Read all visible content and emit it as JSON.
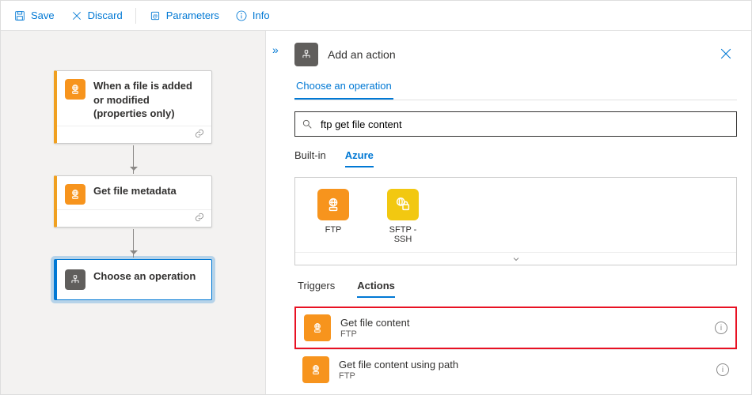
{
  "toolbar": {
    "save": "Save",
    "discard": "Discard",
    "parameters": "Parameters",
    "info": "Info"
  },
  "workflow": {
    "trigger": {
      "title": "When a file is added or modified (properties only)"
    },
    "step1": {
      "title": "Get file metadata"
    },
    "step2": {
      "title": "Choose an operation"
    }
  },
  "panel": {
    "title": "Add an action",
    "subhead": "Choose an operation",
    "search_value": "ftp get file content",
    "source_tabs": {
      "builtin": "Built-in",
      "azure": "Azure"
    },
    "connectors": {
      "ftp": "FTP",
      "sftp": "SFTP - SSH"
    },
    "result_tabs": {
      "triggers": "Triggers",
      "actions": "Actions"
    },
    "actions": [
      {
        "title": "Get file content",
        "sub": "FTP"
      },
      {
        "title": "Get file content using path",
        "sub": "FTP"
      }
    ]
  }
}
